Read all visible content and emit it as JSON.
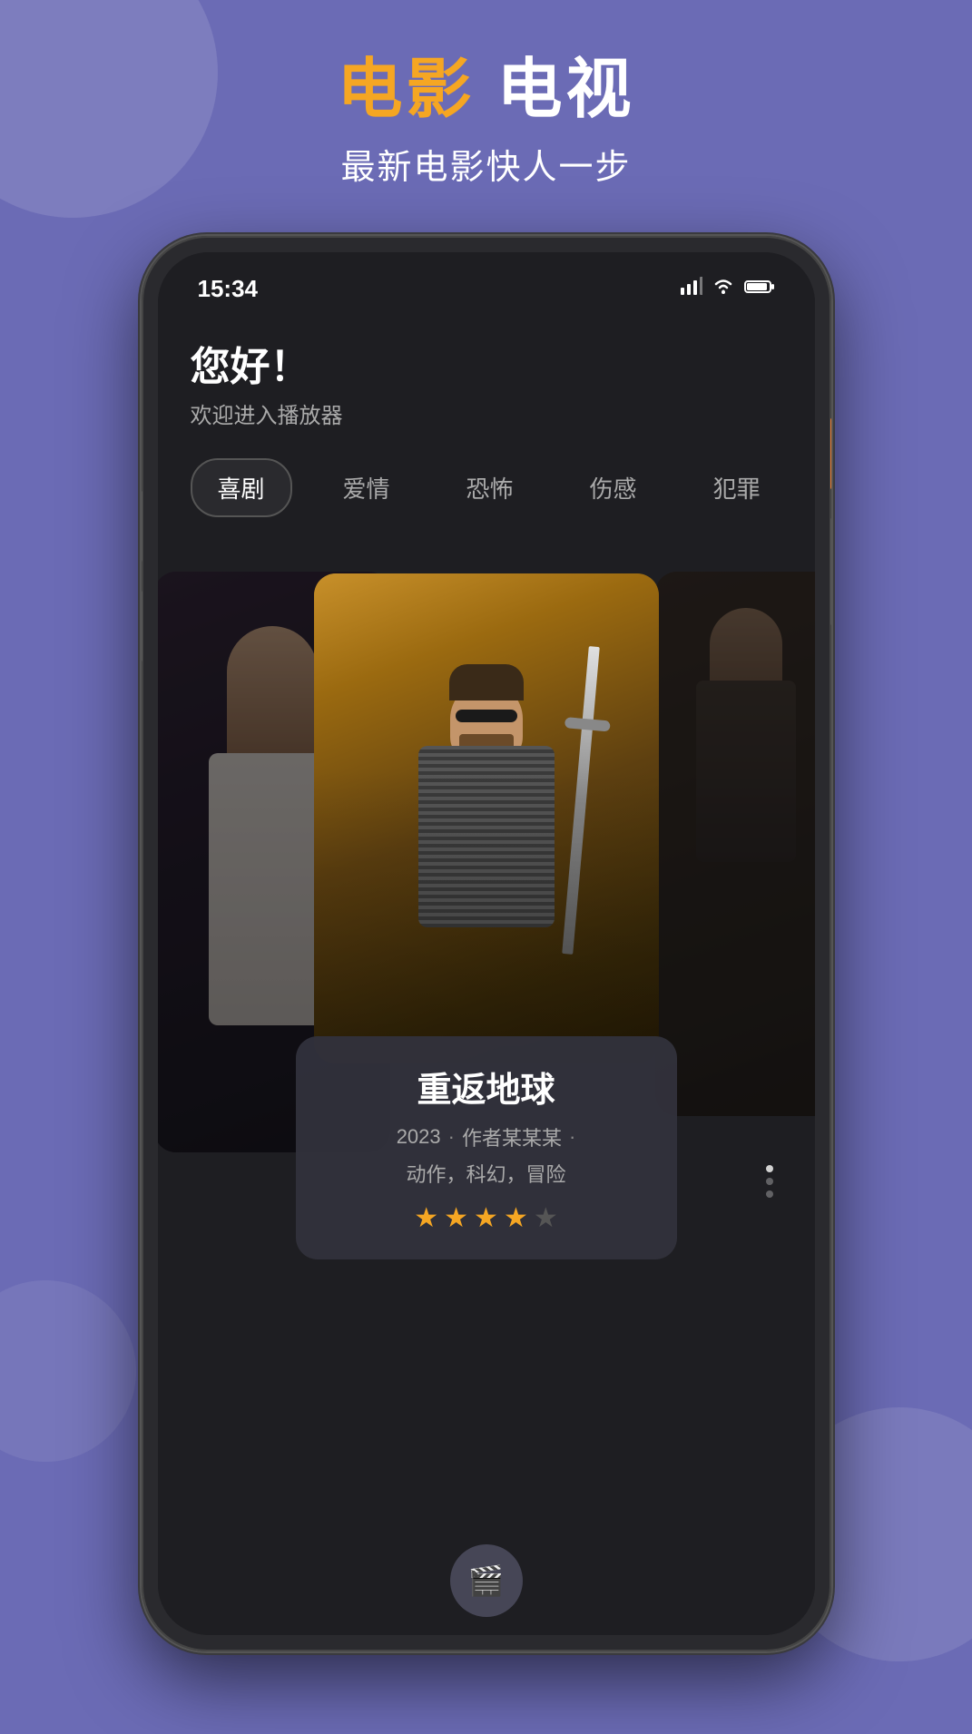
{
  "background": {
    "color": "#6b6bb5"
  },
  "header": {
    "title_orange": "电影",
    "title_white": "电视",
    "subtitle": "最新电影快人一步"
  },
  "statusBar": {
    "time": "15:34",
    "signal": "📶",
    "wifi": "🛜",
    "battery": "🔋"
  },
  "appContent": {
    "greeting": "您好！",
    "subGreeting": "欢迎进入播放器",
    "genreTabs": [
      {
        "label": "喜剧",
        "active": true
      },
      {
        "label": "爱情",
        "active": false
      },
      {
        "label": "恐怖",
        "active": false
      },
      {
        "label": "伤感",
        "active": false
      },
      {
        "label": "犯罪",
        "active": false
      }
    ],
    "featuredMovie": {
      "title": "重返地球",
      "year": "2023",
      "author": "作者某某某",
      "genres": "动作，科幻，冒险",
      "rating": 4,
      "maxRating": 5
    },
    "bottomNav": {
      "icon": "🎬"
    }
  }
}
